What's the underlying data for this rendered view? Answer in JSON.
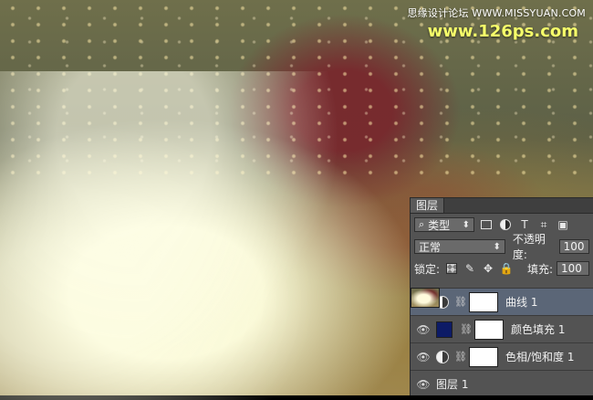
{
  "watermark": {
    "line1": "思缘设计论坛 WWW.MISSYUAN.COM",
    "line2": "www.126ps.com"
  },
  "layers_panel": {
    "tab_label": "图层",
    "filter": {
      "kind_label": "类型"
    },
    "blend": {
      "mode": "正常",
      "opacity_label": "不透明度:",
      "opacity_value": "100"
    },
    "lock": {
      "label": "锁定:",
      "fill_label": "填充:",
      "fill_value": "100"
    },
    "layers": [
      {
        "name": "曲线 1",
        "type": "adjustment",
        "selected": true
      },
      {
        "name": "颜色填充 1",
        "type": "color-fill",
        "swatch": "#0d1b66",
        "selected": false
      },
      {
        "name": "色相/饱和度 1",
        "type": "adjustment",
        "selected": false
      },
      {
        "name": "图层 1",
        "type": "pixel",
        "selected": false
      }
    ]
  }
}
